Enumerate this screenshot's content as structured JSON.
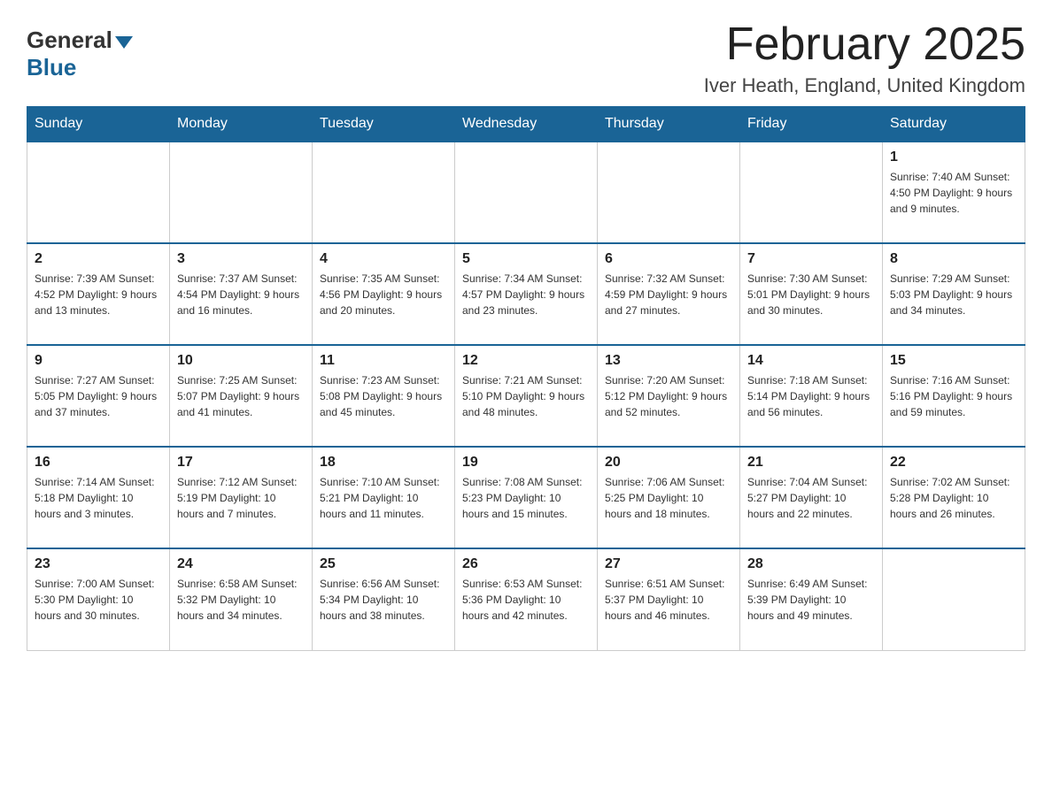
{
  "header": {
    "title": "February 2025",
    "location": "Iver Heath, England, United Kingdom",
    "logo_general": "General",
    "logo_blue": "Blue"
  },
  "weekdays": [
    "Sunday",
    "Monday",
    "Tuesday",
    "Wednesday",
    "Thursday",
    "Friday",
    "Saturday"
  ],
  "weeks": [
    [
      {
        "day": "",
        "info": ""
      },
      {
        "day": "",
        "info": ""
      },
      {
        "day": "",
        "info": ""
      },
      {
        "day": "",
        "info": ""
      },
      {
        "day": "",
        "info": ""
      },
      {
        "day": "",
        "info": ""
      },
      {
        "day": "1",
        "info": "Sunrise: 7:40 AM\nSunset: 4:50 PM\nDaylight: 9 hours and 9 minutes."
      }
    ],
    [
      {
        "day": "2",
        "info": "Sunrise: 7:39 AM\nSunset: 4:52 PM\nDaylight: 9 hours and 13 minutes."
      },
      {
        "day": "3",
        "info": "Sunrise: 7:37 AM\nSunset: 4:54 PM\nDaylight: 9 hours and 16 minutes."
      },
      {
        "day": "4",
        "info": "Sunrise: 7:35 AM\nSunset: 4:56 PM\nDaylight: 9 hours and 20 minutes."
      },
      {
        "day": "5",
        "info": "Sunrise: 7:34 AM\nSunset: 4:57 PM\nDaylight: 9 hours and 23 minutes."
      },
      {
        "day": "6",
        "info": "Sunrise: 7:32 AM\nSunset: 4:59 PM\nDaylight: 9 hours and 27 minutes."
      },
      {
        "day": "7",
        "info": "Sunrise: 7:30 AM\nSunset: 5:01 PM\nDaylight: 9 hours and 30 minutes."
      },
      {
        "day": "8",
        "info": "Sunrise: 7:29 AM\nSunset: 5:03 PM\nDaylight: 9 hours and 34 minutes."
      }
    ],
    [
      {
        "day": "9",
        "info": "Sunrise: 7:27 AM\nSunset: 5:05 PM\nDaylight: 9 hours and 37 minutes."
      },
      {
        "day": "10",
        "info": "Sunrise: 7:25 AM\nSunset: 5:07 PM\nDaylight: 9 hours and 41 minutes."
      },
      {
        "day": "11",
        "info": "Sunrise: 7:23 AM\nSunset: 5:08 PM\nDaylight: 9 hours and 45 minutes."
      },
      {
        "day": "12",
        "info": "Sunrise: 7:21 AM\nSunset: 5:10 PM\nDaylight: 9 hours and 48 minutes."
      },
      {
        "day": "13",
        "info": "Sunrise: 7:20 AM\nSunset: 5:12 PM\nDaylight: 9 hours and 52 minutes."
      },
      {
        "day": "14",
        "info": "Sunrise: 7:18 AM\nSunset: 5:14 PM\nDaylight: 9 hours and 56 minutes."
      },
      {
        "day": "15",
        "info": "Sunrise: 7:16 AM\nSunset: 5:16 PM\nDaylight: 9 hours and 59 minutes."
      }
    ],
    [
      {
        "day": "16",
        "info": "Sunrise: 7:14 AM\nSunset: 5:18 PM\nDaylight: 10 hours and 3 minutes."
      },
      {
        "day": "17",
        "info": "Sunrise: 7:12 AM\nSunset: 5:19 PM\nDaylight: 10 hours and 7 minutes."
      },
      {
        "day": "18",
        "info": "Sunrise: 7:10 AM\nSunset: 5:21 PM\nDaylight: 10 hours and 11 minutes."
      },
      {
        "day": "19",
        "info": "Sunrise: 7:08 AM\nSunset: 5:23 PM\nDaylight: 10 hours and 15 minutes."
      },
      {
        "day": "20",
        "info": "Sunrise: 7:06 AM\nSunset: 5:25 PM\nDaylight: 10 hours and 18 minutes."
      },
      {
        "day": "21",
        "info": "Sunrise: 7:04 AM\nSunset: 5:27 PM\nDaylight: 10 hours and 22 minutes."
      },
      {
        "day": "22",
        "info": "Sunrise: 7:02 AM\nSunset: 5:28 PM\nDaylight: 10 hours and 26 minutes."
      }
    ],
    [
      {
        "day": "23",
        "info": "Sunrise: 7:00 AM\nSunset: 5:30 PM\nDaylight: 10 hours and 30 minutes."
      },
      {
        "day": "24",
        "info": "Sunrise: 6:58 AM\nSunset: 5:32 PM\nDaylight: 10 hours and 34 minutes."
      },
      {
        "day": "25",
        "info": "Sunrise: 6:56 AM\nSunset: 5:34 PM\nDaylight: 10 hours and 38 minutes."
      },
      {
        "day": "26",
        "info": "Sunrise: 6:53 AM\nSunset: 5:36 PM\nDaylight: 10 hours and 42 minutes."
      },
      {
        "day": "27",
        "info": "Sunrise: 6:51 AM\nSunset: 5:37 PM\nDaylight: 10 hours and 46 minutes."
      },
      {
        "day": "28",
        "info": "Sunrise: 6:49 AM\nSunset: 5:39 PM\nDaylight: 10 hours and 49 minutes."
      },
      {
        "day": "",
        "info": ""
      }
    ]
  ]
}
